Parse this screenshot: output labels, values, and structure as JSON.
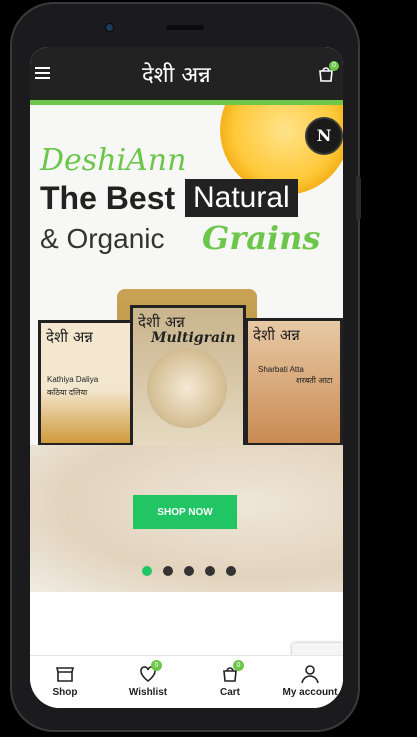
{
  "header": {
    "logo_text": "देशी अन्न",
    "menu_icon": "menu-icon",
    "cart_icon": "cart-icon",
    "cart_count": "0"
  },
  "hero": {
    "brand": "DeshiAnn",
    "line1_a": "The Best",
    "line1_b": "Natural",
    "line2_a": "& Organic",
    "line2_b": "Grains",
    "badge_letter": "N",
    "packs": [
      {
        "title": "देशी अन्न",
        "name": "Kathiya Daliya",
        "subname": "कठिया दलिया"
      },
      {
        "title": "देशी अन्न",
        "name": "Multigrain"
      },
      {
        "title": "देशी अन्न",
        "name": "Sharbati Atta",
        "subname": "शरबती आटा"
      }
    ],
    "cta_label": "SHOP NOW",
    "slides_count": 5,
    "active_slide": 0
  },
  "bottom_nav": [
    {
      "label": "Shop",
      "icon": "shop-icon"
    },
    {
      "label": "Wishlist",
      "icon": "heart-icon",
      "badge": "0"
    },
    {
      "label": "Cart",
      "icon": "cart-icon",
      "badge": "0"
    },
    {
      "label": "My account",
      "icon": "user-icon"
    }
  ],
  "colors": {
    "accent": "#6cc64a",
    "cta": "#22c564",
    "header": "#222222"
  }
}
